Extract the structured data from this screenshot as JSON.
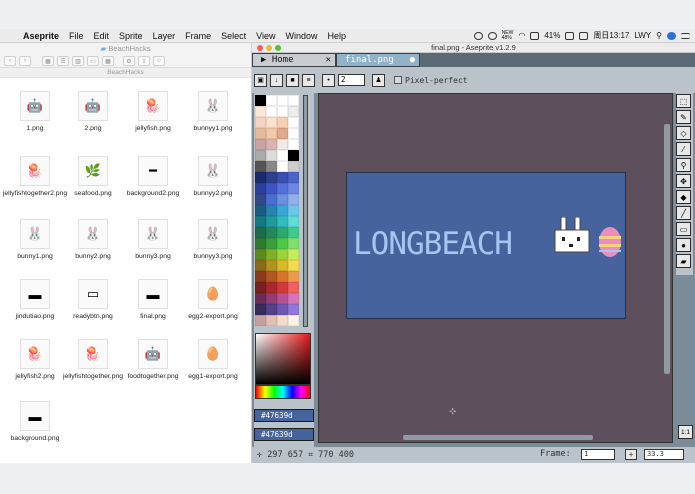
{
  "menubar": {
    "app_name": "Aseprite",
    "items": [
      "File",
      "Edit",
      "Sprite",
      "Layer",
      "Frame",
      "Select",
      "View",
      "Window",
      "Help"
    ],
    "net_label": "NEW\n48%",
    "battery": "41%",
    "datetime": "周日13:17",
    "user": "LWY"
  },
  "finder": {
    "folder_title": "BeachHacks",
    "path_label": "BeachHacks",
    "files": [
      {
        "name": "1.png",
        "icon": "robot-sprite-icon",
        "glyph": "🤖"
      },
      {
        "name": "2.png",
        "icon": "robot-sprite-icon",
        "glyph": "🤖"
      },
      {
        "name": "jellyfish.png",
        "icon": "jellyfish-icon",
        "glyph": "🪼"
      },
      {
        "name": "bunnyy1.png",
        "icon": "bunny-icon",
        "glyph": "🐰"
      },
      {
        "name": "jellyfishtogether2.png",
        "icon": "jellyfish-group-icon",
        "glyph": "🪼"
      },
      {
        "name": "seafood.png",
        "icon": "seaweed-icon",
        "glyph": "🌿"
      },
      {
        "name": "background2.png",
        "icon": "line-image-icon",
        "glyph": "━"
      },
      {
        "name": "bunnyy2.png",
        "icon": "bunny-icon",
        "glyph": "🐰"
      },
      {
        "name": "bunny1.png",
        "icon": "bunny-icon",
        "glyph": "🐰"
      },
      {
        "name": "bunny2.png",
        "icon": "bunny-icon",
        "glyph": "🐰"
      },
      {
        "name": "bunny3.png",
        "icon": "bunny-icon",
        "glyph": "🐰"
      },
      {
        "name": "bunnyy3.png",
        "icon": "bunny-icon",
        "glyph": "🐰"
      },
      {
        "name": "jindutiao.png",
        "icon": "progress-bar-image-icon",
        "glyph": "▬"
      },
      {
        "name": "readybtn.png",
        "icon": "ready-button-image-icon",
        "glyph": "▭"
      },
      {
        "name": "final.png",
        "icon": "banner-image-icon",
        "glyph": "▬"
      },
      {
        "name": "egg2-export.png",
        "icon": "egg-icon",
        "glyph": "🥚"
      },
      {
        "name": "jellyfish2.png",
        "icon": "jellyfish-icon",
        "glyph": "🪼"
      },
      {
        "name": "jellyfishtogether.png",
        "icon": "jellyfish-group-icon",
        "glyph": "🪼"
      },
      {
        "name": "foodtogether.png",
        "icon": "robot-group-icon",
        "glyph": "🤖"
      },
      {
        "name": "egg1-export.png",
        "icon": "egg-icon",
        "glyph": "🥚"
      },
      {
        "name": "background.png",
        "icon": "background-image-icon",
        "glyph": "▬"
      }
    ]
  },
  "aseprite": {
    "window_title": "final.png - Aseprite v1.2.9",
    "tabs": [
      {
        "label": "Home"
      },
      {
        "label": "final.png"
      }
    ],
    "brush_size": "2",
    "pixel_perfect_label": "Pixel-perfect",
    "fg_color": "#47639d",
    "bg_color": "#47639d",
    "artwork_text": "LONGBEACH",
    "status_coords": "297 657",
    "status_size": "770 400",
    "frame_label": "Frame:",
    "frame_value": "1",
    "zoom_value": "33.3"
  },
  "colors": {
    "canvas_bg": "#5d505c",
    "artwork_bg": "#47639d",
    "ui_gray": "#b9c3c9"
  }
}
